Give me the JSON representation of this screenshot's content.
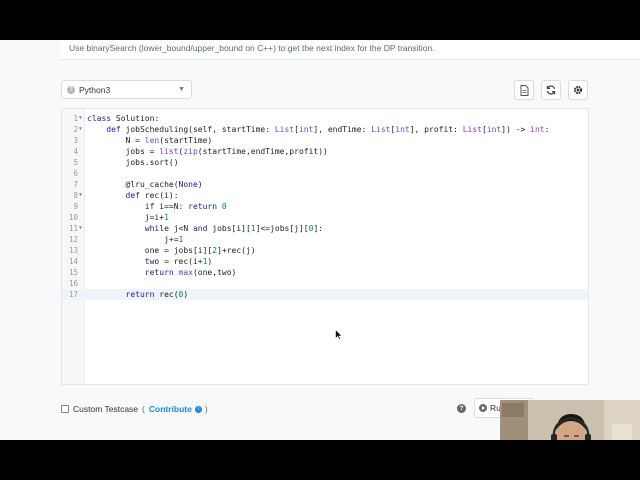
{
  "hint": {
    "text": "Use binarySearch (lower_bound/upper_bound on C++) to get the next index for the DP transition."
  },
  "language_select": {
    "value": "Python3"
  },
  "toolbar": {
    "icons": [
      "file-icon",
      "refresh-icon",
      "gear-icon"
    ]
  },
  "editor": {
    "active_line": 17,
    "lines": [
      {
        "n": "1",
        "fold": true,
        "text": "class Solution:"
      },
      {
        "n": "2",
        "fold": true,
        "text": "    def jobScheduling(self, startTime: List[int], endTime: List[int], profit: List[int]) -> int:"
      },
      {
        "n": "3",
        "fold": false,
        "text": "        N = len(startTime)"
      },
      {
        "n": "4",
        "fold": false,
        "text": "        jobs = list(zip(startTime,endTime,profit))"
      },
      {
        "n": "5",
        "fold": false,
        "text": "        jobs.sort()"
      },
      {
        "n": "6",
        "fold": false,
        "text": ""
      },
      {
        "n": "7",
        "fold": false,
        "text": "        @lru_cache(None)"
      },
      {
        "n": "8",
        "fold": true,
        "text": "        def rec(i):"
      },
      {
        "n": "9",
        "fold": false,
        "text": "            if i==N: return 0"
      },
      {
        "n": "10",
        "fold": false,
        "text": "            j=i+1"
      },
      {
        "n": "11",
        "fold": true,
        "text": "            while j<N and jobs[i][1]<=jobs[j][0]:"
      },
      {
        "n": "12",
        "fold": false,
        "text": "                j+=1"
      },
      {
        "n": "13",
        "fold": false,
        "text": "            one = jobs[i][2]+rec(j)"
      },
      {
        "n": "14",
        "fold": false,
        "text": "            two = rec(i+1)"
      },
      {
        "n": "15",
        "fold": false,
        "text": "            return max(one,two)"
      },
      {
        "n": "16",
        "fold": false,
        "text": ""
      },
      {
        "n": "17",
        "fold": false,
        "text": "        return rec(0)"
      }
    ]
  },
  "footer": {
    "custom_testcase_label": "Custom Testcase",
    "contribute_open": "(",
    "contribute_label": "Contribute",
    "contribute_close": ")",
    "run_label": "Ru"
  },
  "colors": {
    "accent": "#1e88e5",
    "keyword": "#1a1aa6",
    "builtin": "#6f42c1",
    "number": "#098658"
  }
}
